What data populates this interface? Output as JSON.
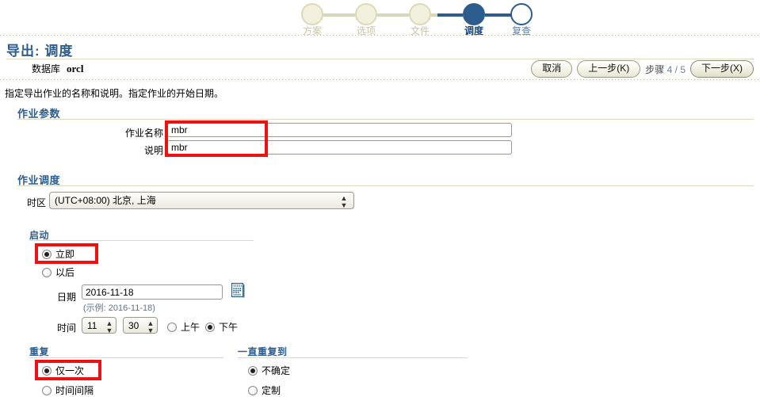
{
  "wizard": {
    "steps": [
      {
        "label": "方案",
        "state": "done"
      },
      {
        "label": "选项",
        "state": "done"
      },
      {
        "label": "文件",
        "state": "done"
      },
      {
        "label": "调度",
        "state": "active"
      },
      {
        "label": "复查",
        "state": "future"
      }
    ],
    "active_color": "#2d5c8f",
    "done_color": "#ddd9b8"
  },
  "header": {
    "title": "导出: 调度",
    "database_label": "数据库",
    "database_value": "orcl"
  },
  "toolbar": {
    "cancel_label": "取消",
    "back_label": "上一步(K)",
    "step_prefix": "步骤",
    "step_current": "4",
    "step_separator": "/",
    "step_total": "5",
    "next_label": "下一步(X)"
  },
  "instruction": "指定导出作业的名称和说明。指定作业的开始日期。",
  "job_params": {
    "section_title": "作业参数",
    "name_label": "作业名称",
    "name_value": "mbr",
    "description_label": "说明",
    "description_value": "mbr"
  },
  "job_schedule": {
    "section_title": "作业调度",
    "timezone_label": "时区",
    "timezone_value": "(UTC+08:00) 北京, 上海",
    "start": {
      "section_title": "启动",
      "immediate_label": "立即",
      "immediate_selected": true,
      "later_label": "以后",
      "later_selected": false,
      "date_label": "日期",
      "date_value": "2016-11-18",
      "date_hint": "(示例: 2016-11-18)",
      "calendar_icon": "calendar-icon",
      "time_label": "时间",
      "time_hour": "11",
      "time_minute": "30",
      "am_label": "上午",
      "am_selected": false,
      "pm_label": "下午",
      "pm_selected": true
    },
    "repeat": {
      "section_title": "重复",
      "once_label": "仅一次",
      "once_selected": true,
      "interval_label": "时间间隔",
      "interval_selected": false
    },
    "repeat_until": {
      "section_title": "一直重复到",
      "indefinite_label": "不确定",
      "indefinite_selected": true,
      "custom_label": "定制",
      "custom_selected": false
    }
  },
  "annotations": {
    "highlight_color": "#ee1111",
    "boxes": [
      {
        "name": "job-name-fields-highlight"
      },
      {
        "name": "start-immediate-highlight"
      },
      {
        "name": "repeat-once-highlight"
      }
    ]
  }
}
